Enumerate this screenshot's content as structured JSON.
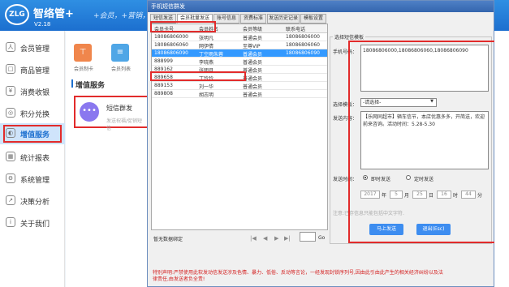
{
  "app": {
    "logo_text": "ZLG",
    "title": "智络管+",
    "version": "V2.18",
    "slogan": "+会员，+营销，+安全..."
  },
  "sidebar": {
    "items": [
      {
        "label": "会员管理",
        "icon": "user-icon"
      },
      {
        "label": "商品管理",
        "icon": "box-icon"
      },
      {
        "label": "消费收银",
        "icon": "yen-icon"
      },
      {
        "label": "积分兑换",
        "icon": "points-icon"
      },
      {
        "label": "增值服务",
        "icon": "service-icon"
      },
      {
        "label": "统计报表",
        "icon": "chart-icon"
      },
      {
        "label": "系统管理",
        "icon": "gear-icon"
      },
      {
        "label": "决策分析",
        "icon": "analysis-icon"
      },
      {
        "label": "关于我们",
        "icon": "info-icon"
      }
    ],
    "active_index": 4
  },
  "middle": {
    "tiles": [
      {
        "label": "会员制卡",
        "color": "#f0864c"
      },
      {
        "label": "会员列表",
        "color": "#4fa6e6"
      }
    ],
    "section_title": "增值服务",
    "sms_card": {
      "title": "短信群发",
      "subtitle": "发送祝福/促销短信"
    }
  },
  "dialog": {
    "title": "手机短信群发",
    "tabs": [
      "短信发送",
      "会员批量发送",
      "账号信息",
      "资费标准",
      "发送历史记录",
      "模板设置"
    ],
    "active_tab": 1,
    "table": {
      "headers": [
        "会员卡号",
        "会员姓名",
        "会员等级",
        "联系电话"
      ],
      "rows": [
        [
          "18086806000",
          "张明凡",
          "普通会员",
          "18086806000"
        ],
        [
          "18086806060",
          "网伊倩",
          "至尊VIP",
          "18086806060"
        ],
        [
          "18086806090",
          "丁空雨朱蓉",
          "普通会员",
          "18086806090"
        ],
        [
          "888999",
          "李晓燕",
          "普通会员",
          ""
        ],
        [
          "889162",
          "张明月",
          "普通会员",
          ""
        ],
        [
          "889658",
          "丁玲玲",
          "普通会员",
          ""
        ],
        [
          "889153",
          "刘一华",
          "普通会员",
          ""
        ],
        [
          "889808",
          "胡志明",
          "普通会员",
          ""
        ]
      ],
      "selected_index": 2
    },
    "pager": {
      "text": "暂无数据绑定",
      "go_label": "Go",
      "nav": [
        "|◀",
        "◀",
        "▶",
        "▶|"
      ]
    },
    "form": {
      "group_title": "选择短信模板",
      "phone_label": "手机号码：",
      "phone_value": "18086806000,18086806060,18086806090",
      "template_label": "选择模板：",
      "template_value": "-请选择-",
      "content_label": "发送内容：",
      "content_value": "【乐网同超市】辆车信节，本店优惠多多，开简送，欢迎前来咨询。活动时间：5.28-5.30",
      "time_label": "发送时间：",
      "time_options": [
        "即时发送",
        "定时发送"
      ],
      "time_selected": 0,
      "datetime": [
        {
          "value": "2017",
          "unit": "年"
        },
        {
          "value": "5",
          "unit": "月"
        },
        {
          "value": "25",
          "unit": "日"
        },
        {
          "value": "16",
          "unit": "时"
        },
        {
          "value": "44",
          "unit": "分"
        }
      ],
      "note": "注意:已存信息只能包括中文字符.",
      "send_button": "马上发送",
      "exit_button": "退出(Esc)"
    },
    "notice": "特别声明:严禁使用此软发动信发送涉及色情、暴力、低俗、反动等言论，一经发现封锁序列号,因由此引由此产生的相关经济纠纷以及法律责任,由发送者负全责!"
  }
}
